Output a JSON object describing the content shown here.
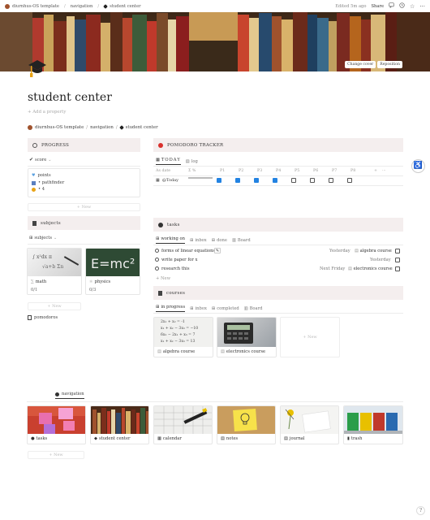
{
  "topbar": {
    "crumbs": [
      "diurnhus-OS template",
      "navigation",
      "student center"
    ],
    "edited": "Edited 5m ago",
    "share": "Share"
  },
  "cover": {
    "change_cover": "Change cover",
    "reposition": "Reposition"
  },
  "page": {
    "title": "student center",
    "add_property": "Add a property"
  },
  "breadcrumb": [
    "diurnhus-OS template",
    "navigation",
    "student center"
  ],
  "progress": {
    "header": "PROGRESS",
    "view": "score",
    "items": [
      "points",
      "• pathfinder",
      "• 4"
    ],
    "new": "New"
  },
  "pomodoro": {
    "header": "POMODORO TRACKER",
    "tabs": [
      "TODAY",
      "log"
    ],
    "columns": [
      "As date",
      "Σ %",
      "P1",
      "P2",
      "P3",
      "P4",
      "P5",
      "P6",
      "P7",
      "P8",
      "+",
      "···"
    ],
    "row_label": "Today",
    "checks": [
      true,
      true,
      true,
      true,
      false,
      false,
      false,
      false
    ]
  },
  "subjects": {
    "header": "subjects",
    "view": "subjects",
    "cards": [
      {
        "name": "math",
        "meta": "0/1"
      },
      {
        "name": "physics",
        "meta": "0/3"
      }
    ],
    "new": "New",
    "pomodoros": "pomodoros"
  },
  "tasks": {
    "header": "tasks",
    "tabs": [
      "working on",
      "inbox",
      "done",
      "Board"
    ],
    "rows": [
      {
        "name": "forms of linear equations",
        "date": "Yesterday",
        "course": "algebra course"
      },
      {
        "name": "write paper for x",
        "date": "Yesterday",
        "course": ""
      },
      {
        "name": "research this",
        "date": "Next Friday",
        "course": "electronics course"
      }
    ],
    "new": "New"
  },
  "courses": {
    "header": "courses",
    "tabs": [
      "in progress",
      "inbox",
      "completed",
      "Board"
    ],
    "cards": [
      "algebra course",
      "electronics course"
    ],
    "new": "New",
    "equations": [
      "2x₁ + x₂ = -1",
      "x₁ + x₂ − 3x₃ = −10",
      "6x₂ − 2x₁ + x₃ = 7",
      "x₁ + x₂ − 3x₃ = 13"
    ]
  },
  "navigation": {
    "tab": "navigation",
    "cards": [
      "tasks",
      "student center",
      "calendar",
      "notes",
      "journal",
      "trash"
    ],
    "new": "New"
  },
  "colors": {
    "header_bg": "#f4eeee",
    "accent": "#2383e2"
  }
}
